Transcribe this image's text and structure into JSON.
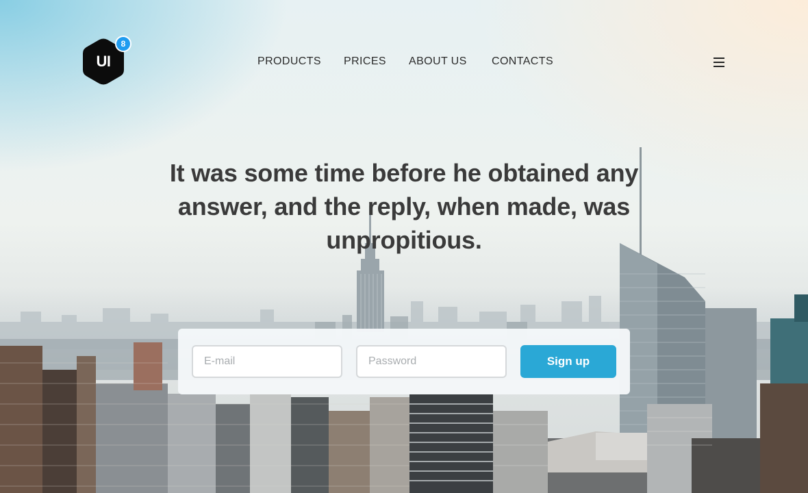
{
  "header": {
    "logo_text": "UI",
    "logo_badge": "8",
    "nav": [
      "PRODUCTS",
      "PRICES",
      "ABOUT US",
      "CONTACTS"
    ]
  },
  "hero": {
    "headline": "It was some time before he obtained any answer, and the reply, when made, was unpropitious."
  },
  "form": {
    "email_placeholder": "E-mail",
    "password_placeholder": "Password",
    "submit_label": "Sign up"
  },
  "colors": {
    "accent": "#2aa8d6",
    "badge": "#1f9cf0",
    "text": "#3a3a3a"
  },
  "icons": [
    "logo-hexagon-icon",
    "menu-hamburger-icon"
  ]
}
